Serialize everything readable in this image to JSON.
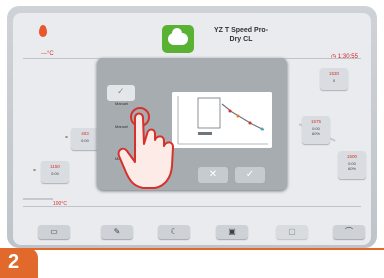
{
  "status": {
    "temperature": "---°C",
    "timer": "1:30:55"
  },
  "program": {
    "title_line1": "YZ T Speed Pro-",
    "title_line2": "Dry CL"
  },
  "parameters": {
    "left_mid": {
      "temp": "403",
      "value": "0:00"
    },
    "left_low": {
      "temp": "1150",
      "value": "0:00"
    },
    "right_top": {
      "temp": "1530",
      "value": "0"
    },
    "right_mid": {
      "temp": "1575",
      "value": "0:00",
      "extra": "60%"
    },
    "right_low": {
      "temp": "1500",
      "value": "0:00",
      "extra": "60%"
    }
  },
  "start_temp": "100°C",
  "dialog": {
    "tabs": [
      "Manuel",
      "Manuel",
      "Manuel"
    ],
    "ok_icon": "check-icon",
    "cancel_icon": "close-icon"
  },
  "toolbar": {
    "items": [
      "screen-icon",
      "edit-icon",
      "moon-icon",
      "save-icon",
      "copy-icon",
      "back-icon"
    ]
  },
  "step_number": "2",
  "colors": {
    "accent": "#e2692c",
    "green": "#59b233",
    "red": "#d6312b"
  }
}
